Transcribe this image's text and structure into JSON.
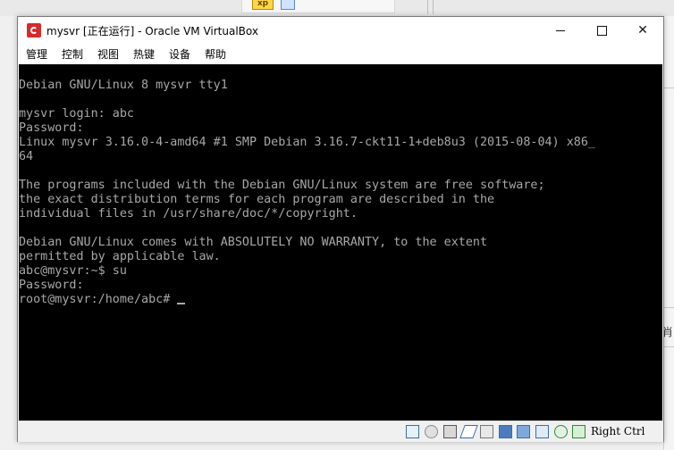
{
  "window": {
    "title": "mysvr [正在运行] - Oracle VM VirtualBox"
  },
  "background": {
    "task_label": "xp",
    "right_char": "肖"
  },
  "menu": [
    "管理",
    "控制",
    "视图",
    "热键",
    "设备",
    "帮助"
  ],
  "console": {
    "lines": [
      "Debian GNU/Linux 8 mysvr tty1",
      "",
      "mysvr login: abc",
      "Password:",
      "Linux mysvr 3.16.0-4-amd64 #1 SMP Debian 3.16.7-ckt11-1+deb8u3 (2015-08-04) x86_",
      "64",
      "",
      "The programs included with the Debian GNU/Linux system are free software;",
      "the exact distribution terms for each program are described in the",
      "individual files in /usr/share/doc/*/copyright.",
      "",
      "Debian GNU/Linux comes with ABSOLUTELY NO WARRANTY, to the extent",
      "permitted by applicable law.",
      "abc@mysvr:~$ su",
      "Password:",
      "root@mysvr:/home/abc# "
    ]
  },
  "statusbar": {
    "host_key": "Right Ctrl",
    "icons": [
      "hard-disk-icon",
      "optical-drive-icon",
      "audio-icon",
      "usb-icon",
      "shared-folders-icon",
      "display-icon",
      "video-capture-icon",
      "cpu-icon",
      "mouse-integration-icon",
      "keyboard-capture-icon"
    ]
  },
  "colors": {
    "console_bg": "#000000",
    "console_fg": "#a8a8a8",
    "titlebar_bg": "#ffffff",
    "statusbar_bg": "#f0f0f0"
  }
}
